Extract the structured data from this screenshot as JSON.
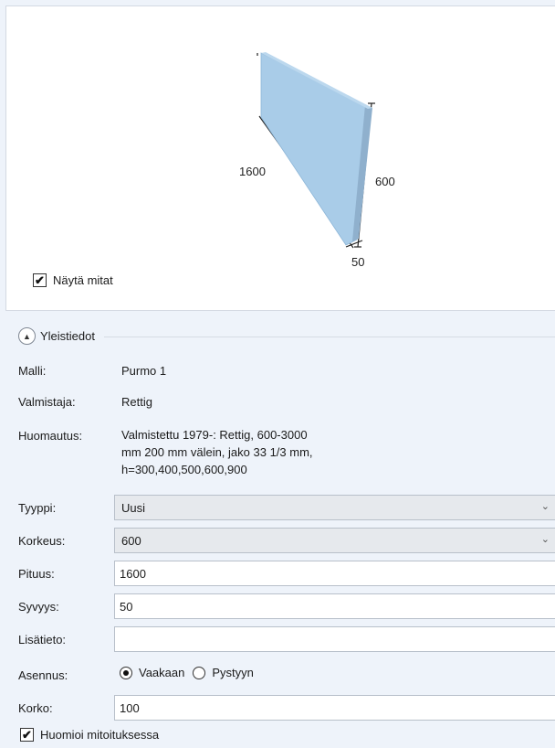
{
  "preview": {
    "length_label": "1600",
    "height_label": "600",
    "depth_label": "50",
    "radiator_color": "#a9cce8",
    "show_dimensions": {
      "label": "Näytä mitat",
      "checked": true
    }
  },
  "section": {
    "title": "Yleistiedot",
    "expanded": true
  },
  "info": {
    "model_label": "Malli:",
    "model_value": "Purmo 1",
    "manufacturer_label": "Valmistaja:",
    "manufacturer_value": "Rettig",
    "note_label": "Huomautus:",
    "note_lines": [
      "Valmistettu 1979-: Rettig, 600-3000",
      "mm 200 mm välein, jako 33 1/3 mm,",
      "h=300,400,500,600,900"
    ]
  },
  "form": {
    "type_label": "Tyyppi:",
    "type_value": "Uusi",
    "height_label": "Korkeus:",
    "height_value": "600",
    "length_label": "Pituus:",
    "length_value": "1600",
    "depth_label": "Syvyys:",
    "depth_value": "50",
    "extra_label": "Lisätieto:",
    "extra_value": "",
    "mounting_label": "Asennus:",
    "mounting_options": [
      {
        "label": "Vaakaan",
        "selected": true
      },
      {
        "label": "Pystyyn",
        "selected": false
      }
    ],
    "elevation_label": "Korko:",
    "elevation_value": "100",
    "consider_label": "Huomioi mitoituksessa",
    "consider_checked": true
  },
  "icons": {
    "collapse": "chevron-up-icon",
    "dropdown": "chevron-down-icon",
    "check": "checkmark-icon"
  }
}
